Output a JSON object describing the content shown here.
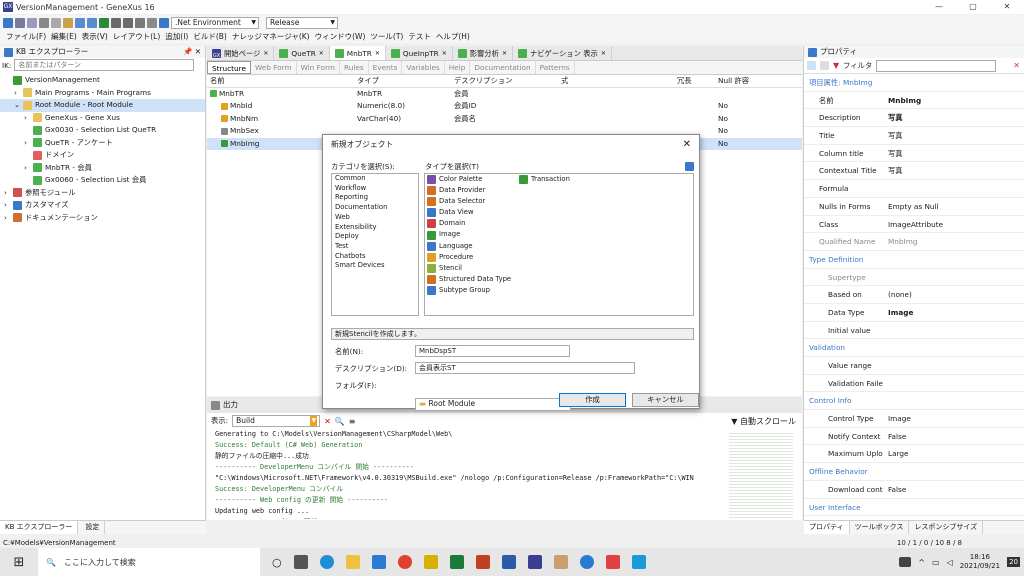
{
  "window": {
    "title": "VersionManagement - GeneXus 16",
    "logo": "GX",
    "controls": [
      "—",
      "▢",
      "✕"
    ]
  },
  "toolbar": {
    "env": ".Net Environment",
    "config": "Release"
  },
  "menu": [
    "ファイル(F)",
    "編集(E)",
    "表示(V)",
    "レイアウト(L)",
    "追加(I)",
    "ビルド(B)",
    "ナレッジマネージャ(K)",
    "ウィンドウ(W)",
    "ツール(T)",
    "テスト",
    "ヘルプ(H)"
  ],
  "kb": {
    "title": "KB エクスプローラー",
    "pin": "📌 ✕",
    "filter_label": "IK:",
    "filter_placeholder": "名前またはパターン",
    "tree": [
      {
        "label": "VersionManagement",
        "indent": 0,
        "exp": "",
        "color": "#3a9a3a"
      },
      {
        "label": "Main Programs - Main Programs",
        "indent": 1,
        "exp": "›",
        "color": "#e7c45a"
      },
      {
        "label": "Root Module - Root Module",
        "indent": 1,
        "exp": "⌄",
        "color": "#e7c45a",
        "sel": true
      },
      {
        "label": "GeneXus - Gene Xus",
        "indent": 2,
        "exp": "›",
        "color": "#e7c45a"
      },
      {
        "label": "Gx0030 - Selection List QueTR",
        "indent": 2,
        "exp": "",
        "color": "#4caf50"
      },
      {
        "label": "QueTR - アンケート",
        "indent": 2,
        "exp": "›",
        "color": "#4caf50"
      },
      {
        "label": "ドメイン",
        "indent": 2,
        "exp": "",
        "color": "#e06060"
      },
      {
        "label": "MnbTR - 会員",
        "indent": 2,
        "exp": "›",
        "color": "#4caf50"
      },
      {
        "label": "Gx0060 - Selection List 会員",
        "indent": 2,
        "exp": "",
        "color": "#4caf50"
      },
      {
        "label": "参照モジュール",
        "indent": 0,
        "exp": "›",
        "color": "#d05050"
      },
      {
        "label": "カスタマイズ",
        "indent": 0,
        "exp": "›",
        "color": "#3a78c9"
      },
      {
        "label": "ドキュメンテーション",
        "indent": 0,
        "exp": "›",
        "color": "#d07030"
      }
    ],
    "bottom_tabs": [
      "KB エクスプローラー",
      "設定"
    ]
  },
  "editor": {
    "tabs": [
      {
        "label": "開始ページ",
        "icon": "GX"
      },
      {
        "label": "QueTR"
      },
      {
        "label": "MnbTR",
        "active": true
      },
      {
        "label": "QueInpTR"
      },
      {
        "label": "影響分析"
      },
      {
        "label": "ナビゲーション 表示"
      }
    ],
    "subtabs": [
      {
        "label": "Structure",
        "active": true
      },
      {
        "label": "Web Form"
      },
      {
        "label": "Win Form"
      },
      {
        "label": "Rules"
      },
      {
        "label": "Events"
      },
      {
        "label": "Variables"
      },
      {
        "label": "Help"
      },
      {
        "label": "Documentation"
      },
      {
        "label": "Patterns"
      }
    ],
    "columns": [
      "名前",
      "タイプ",
      "デスクリプション",
      "式",
      "冗長",
      "Null 許容"
    ],
    "rows": [
      {
        "name": "MnbTR",
        "type": "MnbTR",
        "desc": "会員",
        "nul": "",
        "icon": "green"
      },
      {
        "name": "MnbId",
        "type": "Numeric(8.0)",
        "desc": "会員ID",
        "nul": "No",
        "icon": "key"
      },
      {
        "name": "MnbNm",
        "type": "VarChar(40)",
        "desc": "会員名",
        "nul": "No",
        "icon": "key"
      },
      {
        "name": "MnbSex",
        "type": "",
        "desc": "",
        "nul": "No",
        "icon": "dot"
      },
      {
        "name": "MnbImg",
        "type": "",
        "desc": "",
        "nul": "No",
        "icon": "img",
        "sel": true
      }
    ]
  },
  "dialog": {
    "title": "新規オブジェクト",
    "close": "✕",
    "cat_label": "カテゴリを選択(S):",
    "type_label": "タイプを選択(T)",
    "categories": [
      "Common",
      "Workflow",
      "Reporting",
      "Documentation",
      "Web",
      "Extensibility",
      "Deploy",
      "Test",
      "Chatbots",
      "Smart Devices"
    ],
    "types": [
      {
        "n": "Color Palette",
        "c": "#7a4fa8"
      },
      {
        "n": "Data Provider",
        "c": "#d07020"
      },
      {
        "n": "Data Selector",
        "c": "#d07020"
      },
      {
        "n": "Data View",
        "c": "#3a78c9"
      },
      {
        "n": "Domain",
        "c": "#d04040"
      },
      {
        "n": "Image",
        "c": "#3a9a3a"
      },
      {
        "n": "Language",
        "c": "#3a78c9"
      },
      {
        "n": "Procedure",
        "c": "#e0a020"
      },
      {
        "n": "Stencil",
        "c": "#8ab040"
      },
      {
        "n": "Structured Data Type",
        "c": "#d07020"
      },
      {
        "n": "Subtype Group",
        "c": "#3a78c9"
      }
    ],
    "type_col2": {
      "n": "Transaction",
      "c": "#3a9a3a"
    },
    "info": "新規Stencilを作成します。",
    "name_label": "名前(N):",
    "name_value": "MnbDspST",
    "desc_label": "デスクリプション(D):",
    "desc_value": "会員表示ST",
    "folder_label": "フォルダ(F):",
    "folder_value": "Root Module",
    "ok": "作成",
    "cancel": "キャンセル"
  },
  "output": {
    "title": "出力",
    "show_label": "表示:",
    "show_value": "Build",
    "autoscroll": "自動スクロール",
    "lines": [
      {
        "t": "Generating to C:\\Models\\VersionManagement\\CSharpModel\\Web\\",
        "c": "#1a1a1a"
      },
      {
        "t": "Success: Default (C# Web) Generation",
        "c": "#2e7d32"
      },
      {
        "t": "静的ファイルの圧縮中...成功",
        "c": "#1a1a1a"
      },
      {
        "t": "---------- DeveloperMenu  コンパイル 開始 ----------",
        "c": "#2e7d32"
      },
      {
        "t": "\"C:\\Windows\\Microsoft.NET\\Framework\\v4.0.30319\\MSBuild.exe\" /nologo /p:Configuration=Release /p:FrameworkPath=\"C:\\WIN",
        "c": "#1a1a1a"
      },
      {
        "t": "Success: DeveloperMenu  コンパイル",
        "c": "#2e7d32"
      },
      {
        "t": "---------- Web config の更新 開始 ----------",
        "c": "#2e7d32"
      },
      {
        "t": "Updating web config ...",
        "c": "#1a1a1a"
      },
      {
        "t": "Success: Web config の更新",
        "c": "#2e7d32"
      },
      {
        "t": "Success: すべてビルド",
        "c": "#2e7d32"
      }
    ]
  },
  "props": {
    "title": "プロパティ",
    "filter_label": "フィルタ",
    "rows": [
      {
        "s": "項目属性: MnbImg"
      },
      {
        "k": "名前",
        "v": "MnbImg",
        "b": true
      },
      {
        "k": "Description",
        "v": "写真",
        "b": true
      },
      {
        "k": "Title",
        "v": "写真"
      },
      {
        "k": "Column title",
        "v": "写真"
      },
      {
        "k": "Contextual Title",
        "v": "写真"
      },
      {
        "k": "Formula",
        "v": ""
      },
      {
        "k": "Nulls in Forms",
        "v": "Empty as Null"
      },
      {
        "k": "Class",
        "v": "ImageAttribute"
      },
      {
        "k": "Qualified Name",
        "v": "MnbImg",
        "g": true
      },
      {
        "s": "Type Definition"
      },
      {
        "k": "Supertype",
        "v": "",
        "i": true,
        "g": true
      },
      {
        "k": "Based on",
        "v": "(none)",
        "i": true
      },
      {
        "k": "Data Type",
        "v": "Image",
        "i": true,
        "b": true
      },
      {
        "k": "Initial value",
        "v": "",
        "i": true
      },
      {
        "s": "Validation"
      },
      {
        "k": "Value range",
        "v": "",
        "i": true
      },
      {
        "k": "Validation Failed M",
        "v": "",
        "i": true
      },
      {
        "s": "Control Info"
      },
      {
        "k": "Control Type",
        "v": "Image",
        "i": true
      },
      {
        "k": "Notify Context Cha",
        "v": "False",
        "i": true
      },
      {
        "k": "Maximum Upload",
        "v": "Large",
        "i": true
      },
      {
        "s": "Offline Behavior"
      },
      {
        "k": "Download content",
        "v": "False",
        "i": true
      },
      {
        "s": "User Interface"
      }
    ],
    "bottom_tabs": [
      "プロパティ",
      "ツールボックス",
      "レスポンシブサイズ"
    ],
    "status_right": "10 / 1 / 0 / 10 8 / 8"
  },
  "status": {
    "path": "C:¥Models¥VersionManagement"
  },
  "taskbar": {
    "search": "ここに入力して検索",
    "time": "18:16",
    "date": "2021/09/21",
    "notif": "20"
  }
}
